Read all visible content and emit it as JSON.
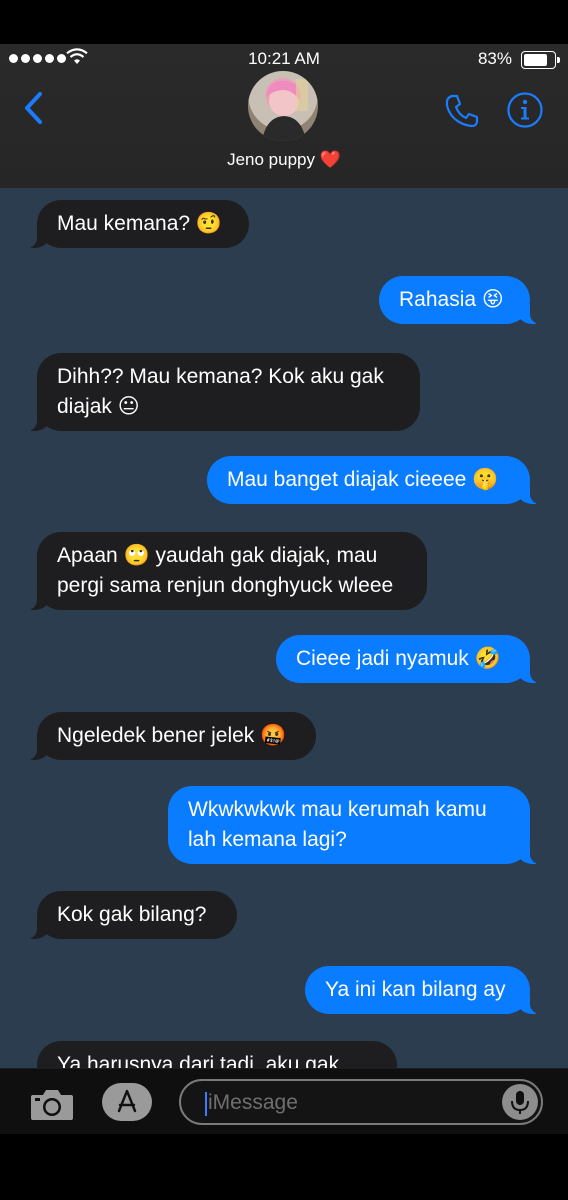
{
  "status_bar": {
    "time": "10:21 AM",
    "battery_percent": "83%",
    "battery_level": 0.83
  },
  "header": {
    "contact_name": "Jeno puppy ❤️"
  },
  "messages": [
    {
      "from": "them",
      "text": "Mau kemana? 🤨"
    },
    {
      "from": "me",
      "text": "Rahasia 😝"
    },
    {
      "from": "them",
      "text": "Dihh?? Mau kemana? Kok aku gak diajak 😐"
    },
    {
      "from": "me",
      "text": "Mau banget diajak cieeee 🤫"
    },
    {
      "from": "them",
      "text": "Apaan 🙄 yaudah gak diajak, mau pergi sama renjun donghyuck wleee"
    },
    {
      "from": "me",
      "text": "Cieee jadi nyamuk 🤣"
    },
    {
      "from": "them",
      "text": "Ngeledek bener jelek 🤬"
    },
    {
      "from": "me",
      "text": "Wkwkwkwk mau kerumah kamu lah kemana lagi?"
    },
    {
      "from": "them",
      "text": "Kok gak bilang?"
    },
    {
      "from": "me",
      "text": "Ya ini kan bilang ay"
    },
    {
      "from": "them",
      "text": "Ya harusnya dari tadi, aku gak"
    }
  ],
  "composer": {
    "placeholder": "iMessage"
  },
  "colors": {
    "thread_bg": "#2b3d4f",
    "incoming": "#1e1e20",
    "outgoing": "#0a7cff",
    "accent": "#1a7cff"
  },
  "icons": [
    "back-chevron-icon",
    "phone-icon",
    "info-icon",
    "camera-icon",
    "app-store-icon",
    "microphone-icon",
    "wifi-icon",
    "battery-icon",
    "signal-dots-icon"
  ]
}
